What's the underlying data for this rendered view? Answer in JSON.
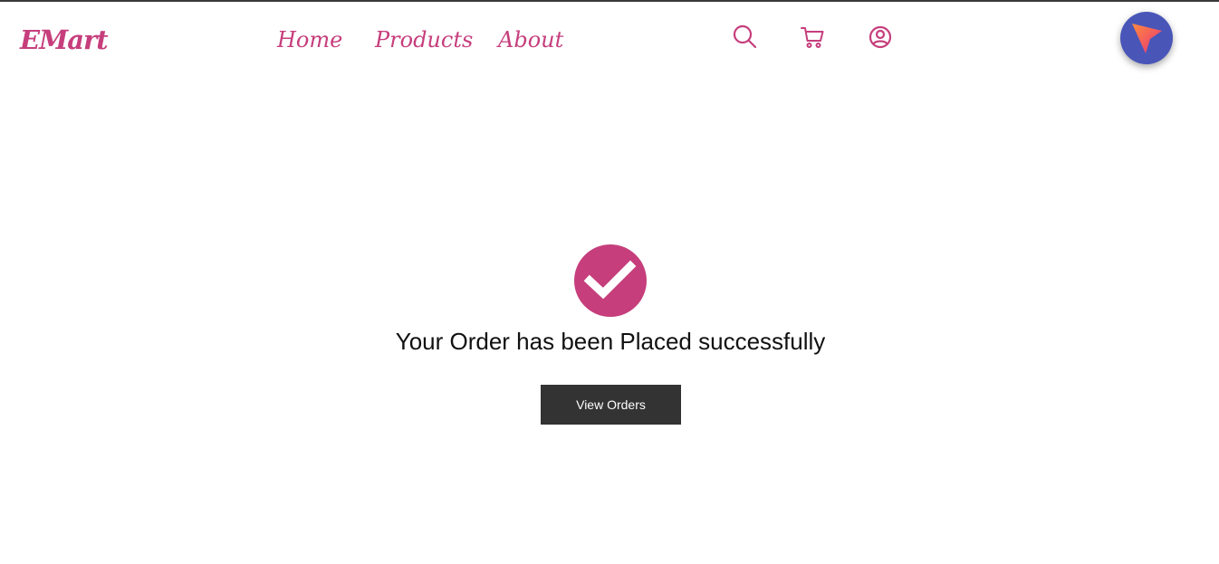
{
  "brand": {
    "name": "EMart",
    "accent_color": "#c63e7c"
  },
  "nav": {
    "links": [
      {
        "label": "Home"
      },
      {
        "label": "Products"
      },
      {
        "label": "About"
      }
    ],
    "icons": [
      "search-icon",
      "cart-icon",
      "user-account-icon"
    ]
  },
  "extension_badge": {
    "icon": "send-arrow-icon",
    "color": "#4956b8"
  },
  "confirmation": {
    "icon": "check-circle-icon",
    "message": "Your Order has been Placed successfully",
    "button_label": "View Orders",
    "button_color": "#333333"
  }
}
